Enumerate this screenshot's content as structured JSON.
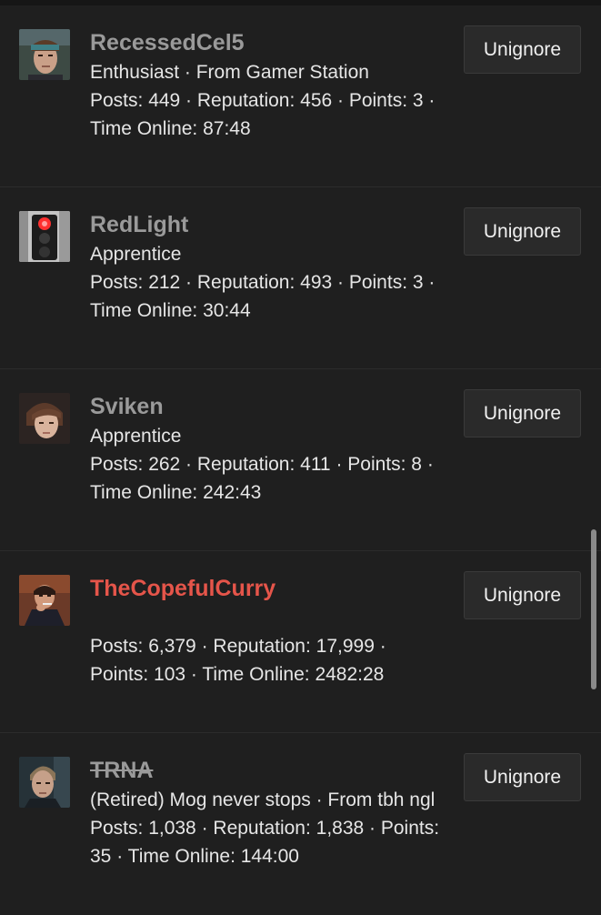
{
  "button_label": "Unignore",
  "users": [
    {
      "username": "RecessedCel5",
      "title": "Enthusiast · From Gamer Station",
      "stats": "Posts: 449 · Reputation: 456 · Points: 3 · Time Online: 87:48",
      "avatar": "avatar-headband-man",
      "name_style": "normal"
    },
    {
      "username": "RedLight",
      "title": "Apprentice",
      "stats": "Posts: 212 · Reputation: 493 · Points: 3 · Time Online: 30:44",
      "avatar": "avatar-traffic-light",
      "name_style": "normal"
    },
    {
      "username": "Sviken",
      "title": "Apprentice",
      "stats": "Posts: 262 · Reputation: 411 · Points: 8 · Time Online: 242:43",
      "avatar": "avatar-young-man",
      "name_style": "normal"
    },
    {
      "username": "TheCopefulCurry",
      "title": "",
      "stats": "Posts: 6,379 · Reputation: 17,999 · Points: 103 · Time Online: 2482:28",
      "avatar": "avatar-man-smoking",
      "name_style": "staff",
      "name_color": "#e5554a"
    },
    {
      "username": "TRNA",
      "title": "(Retired) Mog never stops · From tbh ngl",
      "stats": "Posts: 1,038 · Reputation: 1,838 · Points: 35 · Time Online: 144:00",
      "avatar": "avatar-man-portrait",
      "name_style": "banned"
    }
  ]
}
